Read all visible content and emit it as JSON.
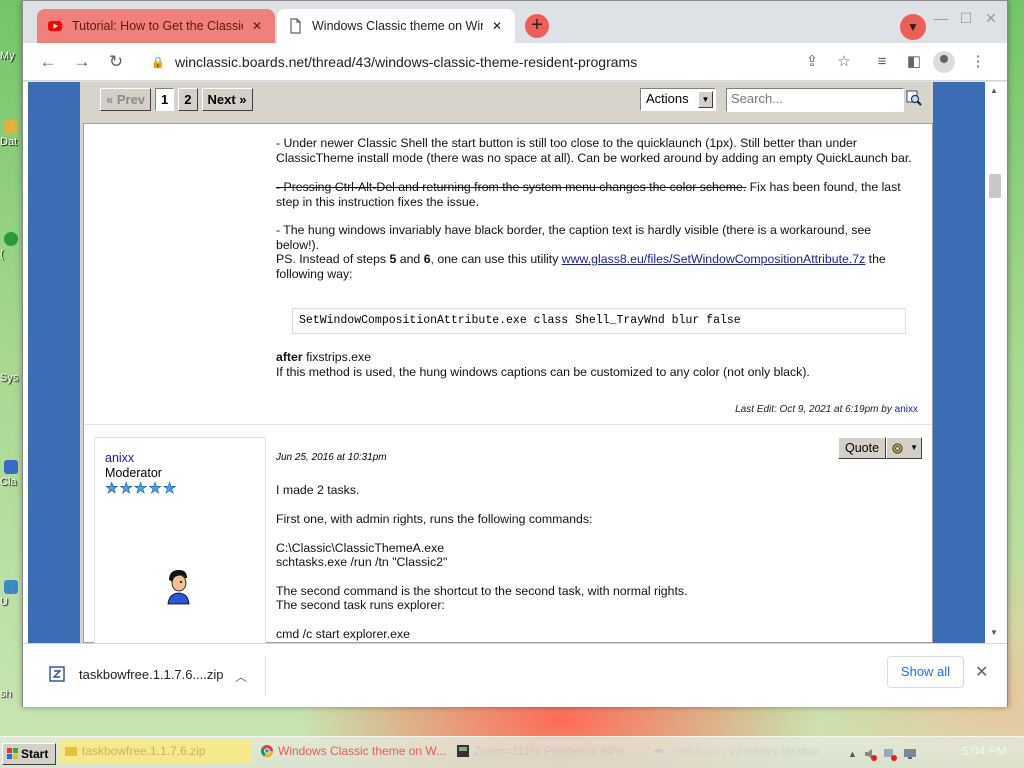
{
  "desktop": {
    "icons": [
      {
        "label": "My"
      },
      {
        "label": "Dat"
      },
      {
        "label": "("
      },
      {
        "label": "Sys"
      },
      {
        "label": "Cla"
      },
      {
        "label": "U"
      },
      {
        "label": "sh"
      }
    ]
  },
  "browser": {
    "tabs": [
      {
        "title": "Tutorial: How to Get the Classic T",
        "icon": "youtube-icon"
      },
      {
        "title": "Windows Classic theme on Wind",
        "icon": "page-icon"
      }
    ],
    "url": "winclassic.boards.net/thread/43/windows-classic-theme-resident-programs"
  },
  "forum": {
    "pager": {
      "prev": "« Prev",
      "pages": [
        "1",
        "2"
      ],
      "next": "Next »"
    },
    "actions_label": "Actions",
    "search_placeholder": "Search..."
  },
  "post1": {
    "p1": "- Under newer Classic Shell the start button is still too close to the quicklaunch (1px). Still better than under ClassicTheme install mode (there was no space at all). Can be worked around by adding an empty QuickLaunch bar.",
    "p2_strike": "- Pressing Ctrl-Alt-Del and returning from the system menu changes the color scheme.",
    "p2_rest": " Fix has been found, the last step in this instruction fixes the issue.",
    "p3": "- The hung windows invariably have black border, the caption text is hardly visible (there is a workaround, see below!).",
    "p4_a": "PS. Instead of steps ",
    "p4_b5": "5",
    "p4_and": " and ",
    "p4_b6": "6",
    "p4_c": ", one can use this utility ",
    "p4_link": "www.glass8.eu/files/SetWindowCompositionAttribute.7z",
    "p4_d": " the following way:",
    "code": "SetWindowCompositionAttribute.exe class Shell_TrayWnd blur false",
    "after_bold": "after",
    "after_rest": " fixstrips.exe",
    "method": "If this method is used, the hung windows captions can be customized to any color (not only black).",
    "last_edit": "Last Edit: Oct 9, 2021 at 6:19pm by ",
    "last_edit_user": "anixx"
  },
  "post2": {
    "username": "anixx",
    "role": "Moderator",
    "stars": 5,
    "date": "Jun 25, 2016 at 10:31pm",
    "quote_label": "Quote",
    "lines": [
      "I made 2 tasks.",
      "First one, with admin rights, runs the following commands:",
      "C:\\Classic\\ClassicThemeA.exe",
      "schtasks.exe /run /tn \"Classic2\"",
      "The second command is the shortcut to the second task, with normal rights.",
      "The second task runs explorer:",
      "cmd /c start explorer.exe"
    ]
  },
  "downloads": {
    "filename": "taskbowfree.1.1.7.6....zip",
    "show_all": "Show all"
  },
  "taskbar": {
    "start": "Start",
    "buttons": [
      {
        "label": "taskbowfree.1.1.7.6.zip",
        "icon": "folder-zip-icon"
      },
      {
        "label": "Windows Classic theme on W...",
        "icon": "chrome-icon"
      },
      {
        "label": "Zoom=111% Pockemul:94% ...",
        "icon": "app-icon"
      },
      {
        "label": "TaskBow - Windows taskbar",
        "icon": "taskbow-icon"
      }
    ],
    "clock": "5:04 PM"
  },
  "colors": {
    "accent_blue": "#3c6cb4",
    "link": "#1a1aa6",
    "tab_active_red": "#ee5e58"
  }
}
